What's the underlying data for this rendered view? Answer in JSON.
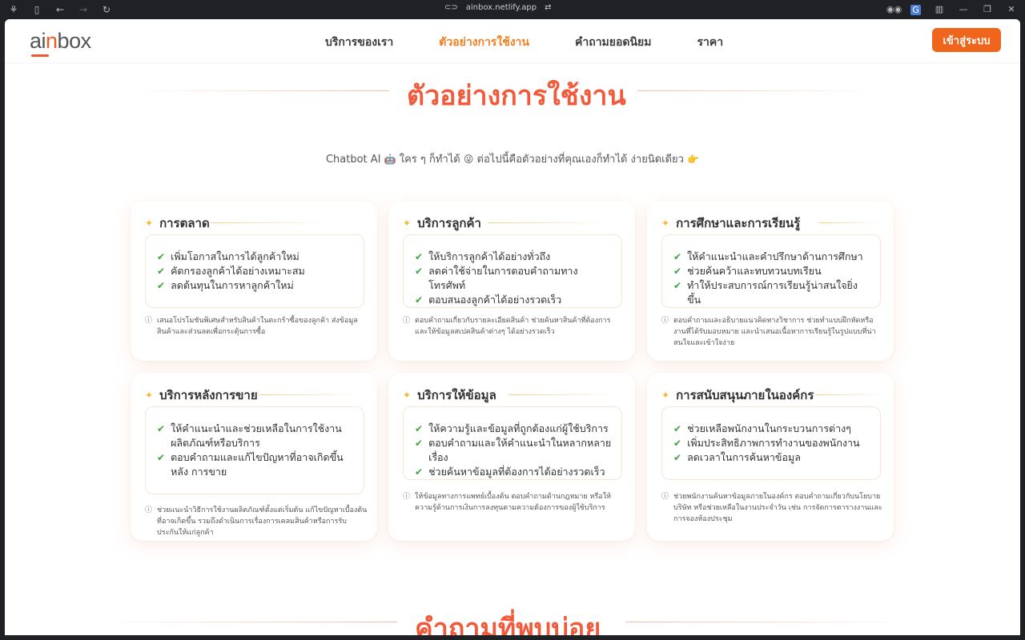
{
  "browser": {
    "url": "ainbox.netlify.app"
  },
  "header": {
    "logo": {
      "ai": "ai",
      "in": "n",
      "box": "box"
    },
    "nav": [
      {
        "label": "บริการของเรา",
        "active": false
      },
      {
        "label": "ตัวอย่างการใช้งาน",
        "active": true
      },
      {
        "label": "คำถามยอดนิยม",
        "active": false
      },
      {
        "label": "ราคา",
        "active": false
      }
    ],
    "login_label": "เข้าสู่ระบบ"
  },
  "examples": {
    "title": "ตัวอย่างการใช้งาน",
    "subtitle_a": "Chatbot AI",
    "subtitle_b": "ใคร ๆ ก็ทำได้",
    "subtitle_c": "ต่อไปนี้คือตัวอย่างที่คุณเองก็ทำได้ ง่ายนิดเดียว",
    "cards": [
      {
        "title": "การตลาด",
        "features": [
          "เพิ่มโอกาสในการได้ลูกค้าใหม่",
          "คัดกรองลูกค้าได้อย่างเหมาะสม",
          "ลดต้นทุนในการหาลูกค้าใหม่"
        ],
        "note": "เสนอโปรโมชันพิเศษสำหรับสินค้าในตะกร้าซื้อของลูกค้า ส่งข้อมูลสินค้าและส่วนลดเพื่อกระตุ้นการซื้อ"
      },
      {
        "title": "บริการลูกค้า",
        "features": [
          "ให้บริการลูกค้าได้อย่างทั่วถึง",
          "ลดค่าใช้จ่ายในการตอบคำถามทางโทรศัพท์",
          "ตอบสนองลูกค้าได้อย่างรวดเร็ว"
        ],
        "note": "ตอบคำถามเกี่ยวกับรายละเอียดสินค้า ช่วยค้นหาสินค้าที่ต้องการ และให้ข้อมูลสเปคสินค้าต่างๆ ได้อย่างรวดเร็ว"
      },
      {
        "title": "การศึกษาและการเรียนรู้",
        "features": [
          "ให้คำแนะนำและคำปรึกษาด้านการศึกษา",
          "ช่วยค้นคว้าและทบทวนบทเรียน",
          "ทำให้ประสบการณ์การเรียนรู้น่าสนใจยิ่งขึ้น"
        ],
        "note": "ตอบคำถามและอธิบายแนวคิดทางวิชาการ ช่วยทำแบบฝึกหัดหรืองานที่ได้รับมอบหมาย และนำเสนอเนื้อหาการเรียนรู้ในรูปแบบที่น่าสนใจและเข้าใจง่าย"
      },
      {
        "title": "บริการหลังการขาย",
        "features": [
          "ให้คำแนะนำและช่วยเหลือในการใช้งาน ผลิตภัณฑ์หรือบริการ",
          "ตอบคำถามและแก้ไขปัญหาที่อาจเกิดขึ้นหลัง การขาย"
        ],
        "note": "ช่วยแนะนำวิธีการใช้งานผลิตภัณฑ์ตั้งแต่เริ่มต้น แก้ไขปัญหาเบื้องต้นที่อาจเกิดขึ้น รวมถึงดำเนินการเรื่องการเคลมสินค้าหรือการรับประกันให้แก่ลูกค้า"
      },
      {
        "title": "บริการให้ข้อมูล",
        "features": [
          "ให้ความรู้และข้อมูลที่ถูกต้องแก่ผู้ใช้บริการ",
          "ตอบคำถามและให้คำแนะนำในหลากหลายเรื่อง",
          "ช่วยค้นหาข้อมูลที่ต้องการได้อย่างรวดเร็ว"
        ],
        "note": "ให้ข้อมูลทางการแพทย์เบื้องต้น ตอบคำถามด้านกฎหมาย หรือให้ความรู้ด้านการเงินการลงทุนตามความต้องการของผู้ใช้บริการ"
      },
      {
        "title": "การสนับสนุนภายในองค์กร",
        "features": [
          "ช่วยเหลือพนักงานในกระบวนการต่างๆ",
          "เพิ่มประสิทธิภาพการทำงานของพนักงาน",
          "ลดเวลาในการค้นหาข้อมูล"
        ],
        "note": "ช่วยพนักงานค้นหาข้อมูลภายในองค์กร ตอบคำถามเกี่ยวกับนโยบายบริษัท หรือช่วยเหลือในงานประจำวัน เช่น การจัดการตารางงานและการจองห้องประชุม"
      }
    ]
  },
  "faq": {
    "title": "คำถามที่พบบ่อย"
  }
}
